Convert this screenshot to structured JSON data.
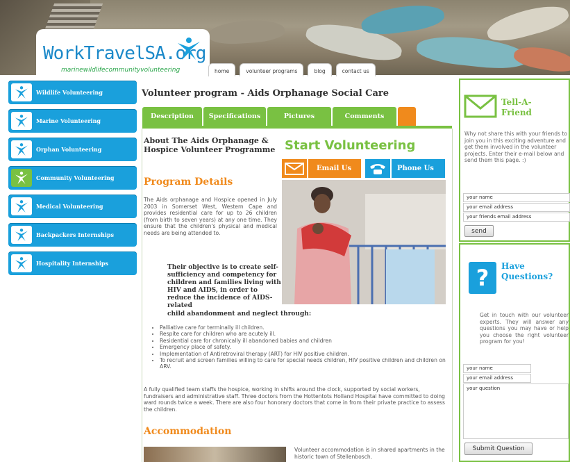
{
  "header": {
    "logo_text": "WorkTravelSA.org",
    "logo_tagline": "marinewildlifecommunityvolunteering",
    "nav": [
      "home",
      "volunteer programs",
      "blog",
      "contact us"
    ]
  },
  "sidebar": {
    "items": [
      {
        "label": "Wildlife Volunteering"
      },
      {
        "label": "Marine Volunteering"
      },
      {
        "label": "Orphan Volunteering"
      },
      {
        "label": "Community Volunteering"
      },
      {
        "label": "Medical Volunteering"
      },
      {
        "label": "Backpackers Internships"
      },
      {
        "label": "Hospitality Internships"
      }
    ]
  },
  "main": {
    "title": "Volunteer program - Aids Orphanage Social Care",
    "tabs": [
      "Description",
      "Specifications",
      "Pictures",
      "Comments"
    ],
    "about_heading": "About The Aids Orphanage & Hospice Volunteer Programme",
    "program_details_heading": "Program Details",
    "program_details_text": "The Aids orphanage and Hospice opened in July 2003 in Somerset West, Western Cape and provides residential care for up to 26 children (from birth to seven years) at any one time. They ensure that the children's physical and medical needs are being attended to.",
    "objective_text": "Their objective is to create self-sufficiency and competency for children and families living with HIV and AIDS, in order to reduce the incidence of AIDS-related",
    "objective_tail": "child abandonment and neglect through:",
    "bullets": [
      "Palliative care for terminally ill children.",
      "Respite care for children who are acutely ill.",
      "Residential care for chronically ill abandoned babies and children",
      "Emergency place of safety.",
      "Implementation of Antiretroviral therapy (ART) for HIV positive children.",
      "To recruit and screen families willing to care for special needs children, HIV positive children and children on ARV."
    ],
    "team_text": "A fully qualified team staffs the hospice, working in shifts around the clock, supported by social workers, fundraisers and administrative staff. Three doctors from the Hottentots Holland Hospital have committed to doing ward rounds twice a week. There are also four honorary doctors that come in from their private practice to assess the children.",
    "accommodation_heading": "Accommodation",
    "accommodation_text": "Volunteer accommodation is in shared apartments in the historic town of Stellenbosch.",
    "start_volunteering": "Start Volunteering",
    "email_label": "Email Us",
    "phone_label": "Phone Us"
  },
  "tell_a_friend": {
    "title_line1": "Tell-A-",
    "title_line2": "Friend",
    "text": "Why not share this with your friends to join you in this exciting adventure and get them involved in the volunteer projects. Enter their e-mail below and send them this page. :)",
    "your_name": "your name",
    "your_email": "your email address",
    "friends_email": "your friends email address",
    "send_label": "send"
  },
  "questions": {
    "title_line1": "Have",
    "title_line2": "Questions?",
    "text": "Get in touch with our volunteer experts. They will answer any questions you may have or help you choose the right volunteer program for you!",
    "your_name": "your name",
    "your_email": "your email address",
    "your_question": "your question",
    "submit_label": "Submit Question"
  },
  "colors": {
    "green": "#79c142",
    "blue": "#1aa0dc",
    "orange": "#f08a1c"
  }
}
